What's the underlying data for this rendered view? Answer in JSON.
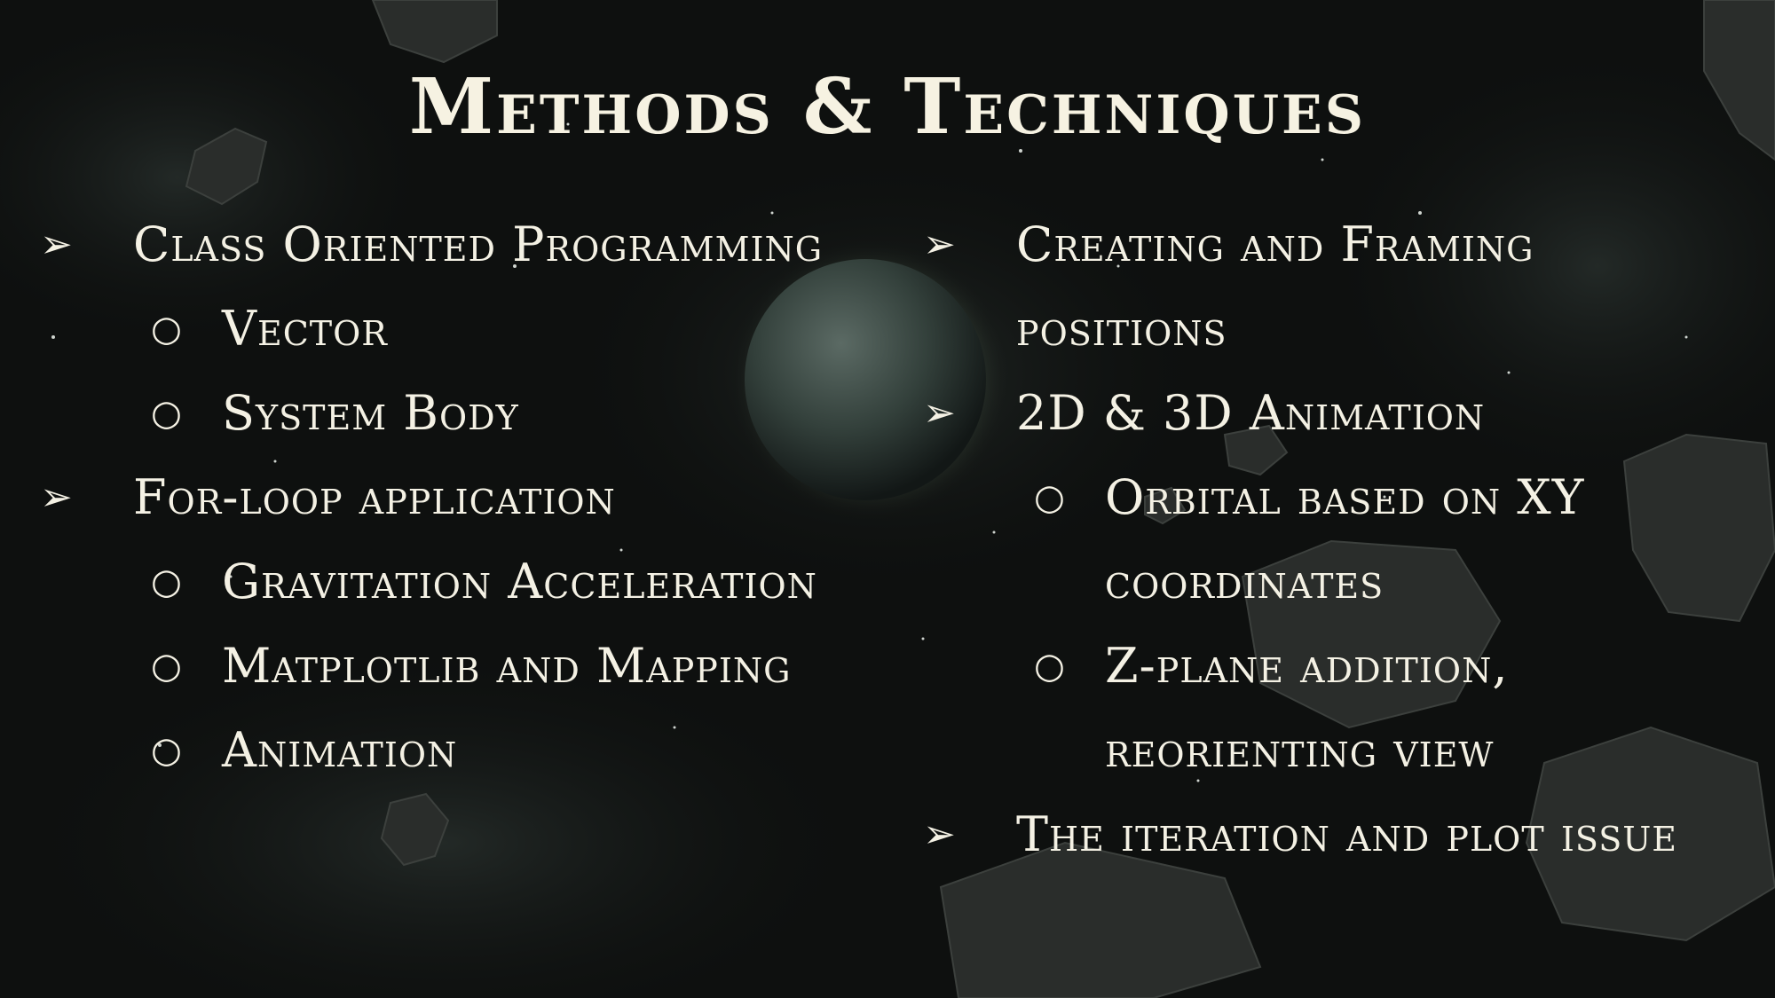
{
  "slide": {
    "title": "Methods & Techniques",
    "bullet_arrow": "➢",
    "bullet_circle": "○",
    "left_column": {
      "items": [
        {
          "text": "Class Oriented Programming"
        },
        {
          "text": "Vector"
        },
        {
          "text": "System Body"
        },
        {
          "text": "For-loop application"
        },
        {
          "text": "Gravitation Acceleration"
        },
        {
          "text": "Matplotlib and Mapping"
        },
        {
          "text": "Animation"
        }
      ]
    },
    "right_column": {
      "items": [
        {
          "text": "Creating and Framing"
        },
        {
          "text": "positions"
        },
        {
          "text": "2D & 3D Animation"
        },
        {
          "text": "Orbital based on XY"
        },
        {
          "text": "coordinates"
        },
        {
          "text": "Z-plane addition,"
        },
        {
          "text": "reorienting view"
        },
        {
          "text": "The iteration and plot issue"
        }
      ]
    }
  },
  "colors": {
    "background": "#0d0f0e",
    "text": "#f4f1e4",
    "planet": "#3a4541"
  }
}
